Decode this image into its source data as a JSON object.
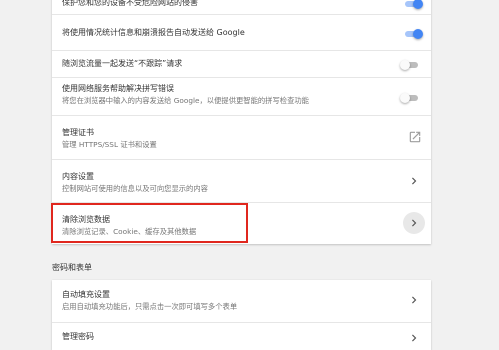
{
  "privacy_section": {
    "rows": [
      {
        "label": "保护您和您的设备不受危险网站的侵害",
        "toggle_state": "on"
      },
      {
        "label": "将使用情况统计信息和崩溃报告自动发送给 Google",
        "toggle_state": "on"
      },
      {
        "label": "随浏览流量一起发送“不跟踪”请求",
        "toggle_state": "off"
      },
      {
        "label": "使用网络服务帮助解决拼写错误",
        "sublabel": "将您在浏览器中输入的内容发送给 Google，以便提供更智能的拼写检查功能",
        "toggle_state": "off"
      },
      {
        "label": "管理证书",
        "sublabel": "管理 HTTPS/SSL 证书和设置",
        "icon": "open-in-new-icon"
      },
      {
        "label": "内容设置",
        "sublabel": "控制网站可使用的信息以及可向您显示的内容",
        "icon": "chevron-right-icon"
      },
      {
        "label": "清除浏览数据",
        "sublabel": "清除浏览记录、Cookie、缓存及其他数据",
        "icon": "chevron-right-icon",
        "highlighted": true
      }
    ]
  },
  "passwords_section": {
    "title": "密码和表单",
    "rows": [
      {
        "label": "自动填充设置",
        "sublabel": "启用自动填充功能后，只需点击一次即可填写多个表单",
        "icon": "chevron-right-icon"
      },
      {
        "label": "管理密码",
        "icon": "chevron-right-icon"
      }
    ]
  },
  "colors": {
    "toggle_on": "#4285f4",
    "highlight_border": "#e0271e",
    "page_bg": "#f1f1f1"
  }
}
